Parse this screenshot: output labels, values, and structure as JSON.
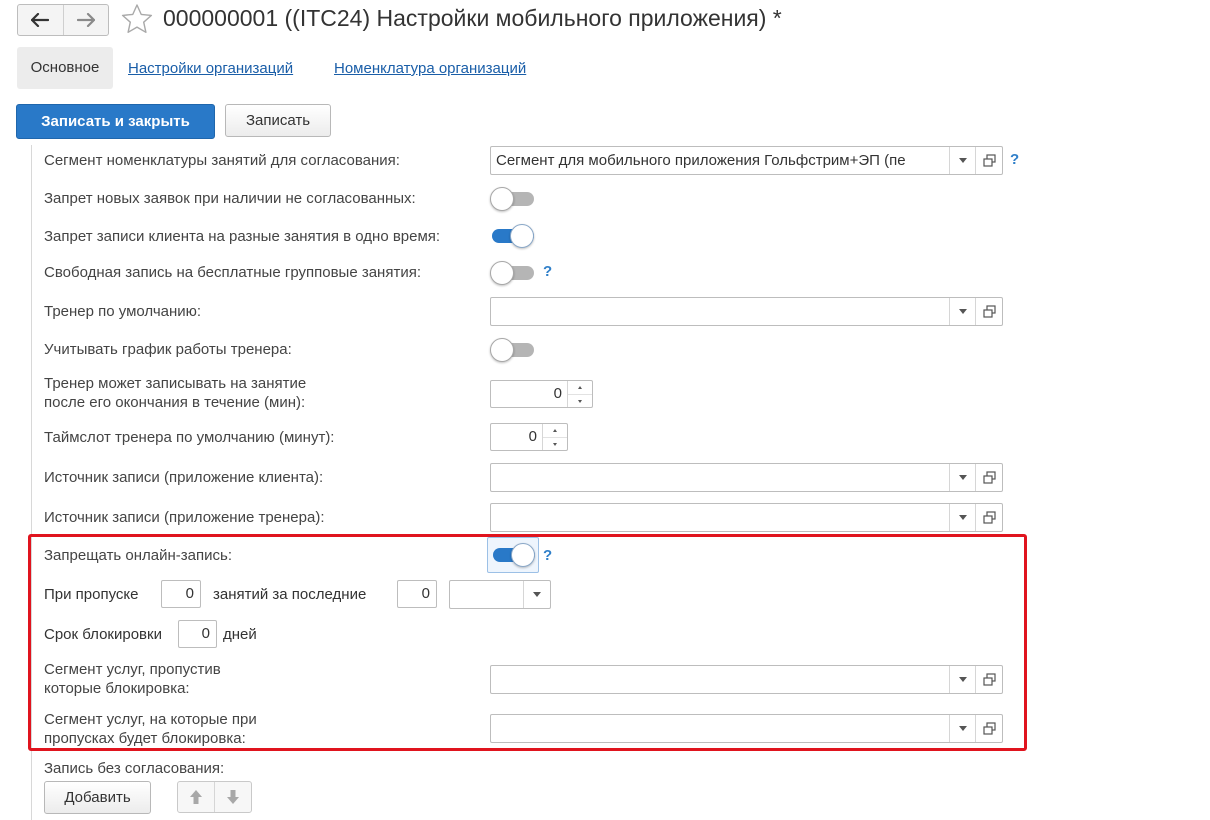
{
  "window": {
    "title": "000000001 ((ITC24) Настройки мобильного приложения) *"
  },
  "tabs": [
    {
      "label": "Основное",
      "active": true
    },
    {
      "label": "Настройки организаций",
      "active": false
    },
    {
      "label": "Номенклатура организаций",
      "active": false
    }
  ],
  "toolbar": {
    "save_close_label": "Записать и закрыть",
    "save_label": "Записать"
  },
  "form": {
    "segment_approval": {
      "label": "Сегмент номенклатуры занятий для согласования:",
      "value": "Сегмент для мобильного приложения Гольфстрим+ЭП (пе",
      "help": "?"
    },
    "ban_new_requests": {
      "label": "Запрет новых заявок при наличии не согласованных:",
      "on": false
    },
    "ban_overlap": {
      "label": "Запрет записи клиента на разные занятия в одно время:",
      "on": true
    },
    "free_group": {
      "label": "Свободная запись на бесплатные групповые занятия:",
      "on": false,
      "help": "?"
    },
    "default_trainer": {
      "label": "Тренер по умолчанию:",
      "value": ""
    },
    "trainer_schedule": {
      "label": "Учитывать график работы тренера:",
      "on": false
    },
    "trainer_after_end": {
      "label_line1": "Тренер может записывать на занятие",
      "label_line2": "после его окончания в течение (мин):",
      "value": "0"
    },
    "trainer_timeslot": {
      "label": "Таймслот тренера по умолчанию (минут):",
      "value": "0"
    },
    "source_client": {
      "label": "Источник записи (приложение клиента):",
      "value": ""
    },
    "source_trainer": {
      "label": "Источник записи (приложение тренера):",
      "value": ""
    },
    "ban_online": {
      "label": "Запрещать онлайн-запись:",
      "on": true,
      "help": "?"
    },
    "skip_rule": {
      "label_prefix": "При пропуске",
      "skip_count": "0",
      "label_middle": "занятий за последние",
      "period_count": "0",
      "period_unit": ""
    },
    "block_term": {
      "label_prefix": "Срок блокировки",
      "value": "0",
      "label_suffix": "дней"
    },
    "segment_skipped": {
      "label_line1": "Сегмент услуг, пропустив",
      "label_line2": "которые блокировка:",
      "value": ""
    },
    "segment_blocked": {
      "label_line1": "Сегмент услуг, на которые при",
      "label_line2": "пропусках будет блокировка:",
      "value": ""
    },
    "no_approval": {
      "label": "Запись без согласования:",
      "add_label": "Добавить"
    }
  },
  "icons": {
    "back": "arrow-left-icon",
    "forward": "arrow-right-icon",
    "favorite": "star-icon",
    "dropdown": "chevron-down-icon",
    "open": "open-form-icon",
    "move_up": "arrow-up-icon",
    "move_down": "arrow-down-icon"
  },
  "colors": {
    "accent": "#2979c8",
    "link": "#1a5ea8",
    "highlight": "#e0141e",
    "help": "#2f7fc9"
  }
}
